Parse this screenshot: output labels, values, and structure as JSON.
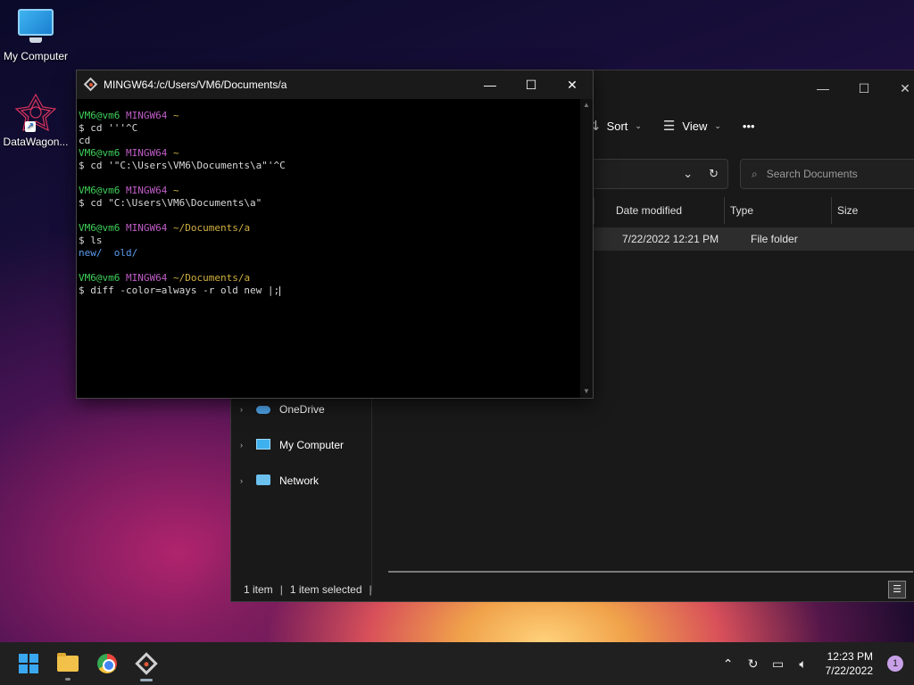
{
  "desktop": {
    "icons": [
      {
        "label": "My Computer"
      },
      {
        "label": "DataWagon..."
      }
    ]
  },
  "explorer": {
    "controls": {
      "minimize": "—",
      "maximize": "☐",
      "close": "✕"
    },
    "toolbar": {
      "sort_label": "Sort",
      "view_label": "View",
      "more_label": "•••"
    },
    "search": {
      "placeholder": "Search Documents"
    },
    "columns": [
      "Date modified",
      "Type",
      "Size"
    ],
    "rows": [
      {
        "date_modified": "7/22/2022 12:21 PM",
        "type": "File folder",
        "size": ""
      }
    ],
    "nav": [
      {
        "label": "OneDrive"
      },
      {
        "label": "My Computer"
      },
      {
        "label": "Network"
      }
    ],
    "status": {
      "item_count": "1 item",
      "selected": "1 item selected"
    }
  },
  "terminal": {
    "title": "MINGW64:/c/Users/VM6/Documents/a",
    "controls": {
      "minimize": "—",
      "maximize": "☐",
      "close": "✕"
    },
    "lines": {
      "p1_user": "VM6@vm6",
      "p1_host": "MINGW64",
      "p1_dir": "~",
      "c1": "$ cd '''^C",
      "o1": "cd",
      "p2_user": "VM6@vm6",
      "p2_host": "MINGW64",
      "p2_dir": "~",
      "c2": "$ cd '\"C:\\Users\\VM6\\Documents\\a\"'^C",
      "p3_user": "VM6@vm6",
      "p3_host": "MINGW64",
      "p3_dir": "~",
      "c3": "$ cd \"C:\\Users\\VM6\\Documents\\a\"",
      "p4_user": "VM6@vm6",
      "p4_host": "MINGW64",
      "p4_dir": "~/Documents/a",
      "c4": "$ ls",
      "o4_a": "new/",
      "o4_b": "old/",
      "p5_user": "VM6@vm6",
      "p5_host": "MINGW64",
      "p5_dir": "~/Documents/a",
      "c5": "$ diff -color=always -r old new |;"
    }
  },
  "taskbar": {
    "time": "12:23 PM",
    "date": "7/22/2022",
    "notifications": "1"
  },
  "colors": {
    "prompt_user": "#3fd05a",
    "prompt_host": "#c05ec8",
    "prompt_dir": "#d0b040",
    "dir_listing": "#5a9cf0"
  }
}
